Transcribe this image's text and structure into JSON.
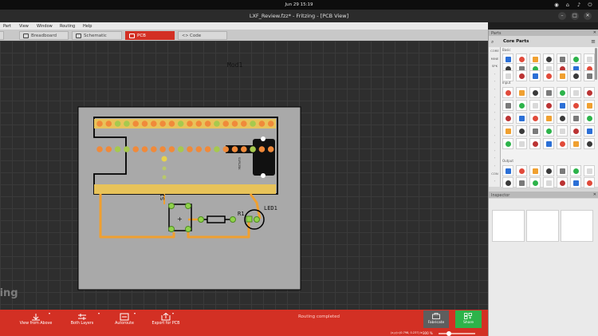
{
  "system": {
    "clock": "Jun 29  15:19"
  },
  "window": {
    "title": "LXF_Review.fzz* - Fritzing - [PCB View]"
  },
  "menu": {
    "items": [
      "Part",
      "View",
      "Window",
      "Routing",
      "Help"
    ]
  },
  "tabs": [
    {
      "label": "Breadboard",
      "active": false
    },
    {
      "label": "Schematic",
      "active": false
    },
    {
      "label": "PCB",
      "active": true
    },
    {
      "label": "Code",
      "active": false
    }
  ],
  "canvas": {
    "module_label": "Mod1",
    "switch_label": "S1",
    "resistor_label": "R1",
    "led_label": "LED1",
    "module_chip_text": "S1P125K",
    "watermark": "zing"
  },
  "toolbar": {
    "view_from_above": "View from Above",
    "both_layers": "Both Layers",
    "autoroute": "Autoroute",
    "export_for_pcb": "Export for PCB",
    "status": "Routing completed",
    "coords": "(x,y)=(0.798, 0.237) in",
    "zoom": "300 %",
    "fabricate": "Fabricate",
    "share": "Share"
  },
  "parts_panel": {
    "header": "Parts",
    "title": "Core Parts",
    "bins": [
      "CORE",
      "MINE",
      "SPK",
      "",
      "",
      "",
      "",
      "",
      "",
      "",
      "",
      "",
      "",
      "",
      "",
      "",
      "CON",
      ""
    ],
    "section_core": "Basic",
    "section_input": "Input",
    "section_output": "Output"
  },
  "inspector": {
    "header": "Inspector"
  },
  "colors": {
    "accent": "#d33024",
    "share": "#2db34a",
    "pcb": "#a9a9a9",
    "trace": "#f0a030",
    "pad": "#8fd24a"
  }
}
